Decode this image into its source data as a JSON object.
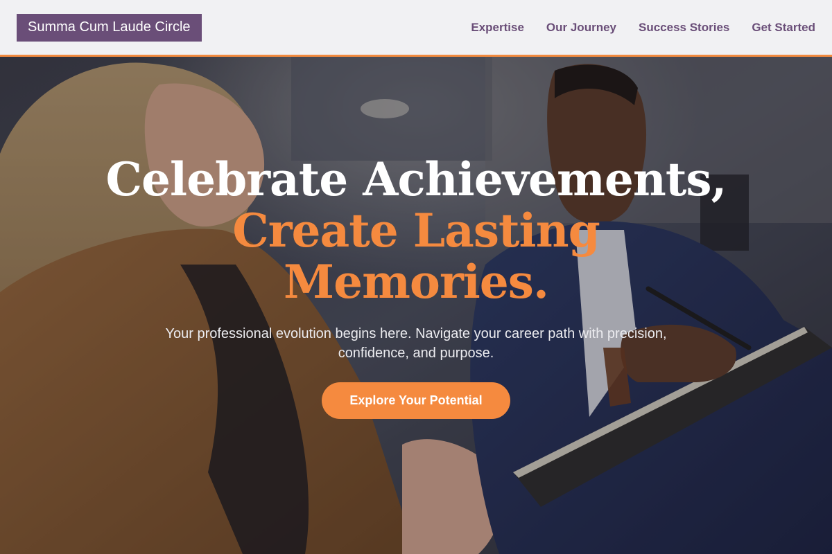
{
  "header": {
    "brand": "Summa Cum Laude Circle",
    "nav": [
      {
        "label": "Expertise"
      },
      {
        "label": "Our Journey"
      },
      {
        "label": "Success Stories"
      },
      {
        "label": "Get Started"
      }
    ]
  },
  "hero": {
    "headline_line1": "Celebrate Achievements,",
    "headline_line2": "Create Lasting",
    "headline_line3": "Memories.",
    "subtext": "Your professional evolution begins here. Navigate your career path with precision, confidence, and purpose.",
    "cta_label": "Explore Your Potential"
  },
  "colors": {
    "brand_purple": "#6a4e78",
    "accent_orange": "#f58a3f",
    "header_bg": "#f1f1f3"
  }
}
